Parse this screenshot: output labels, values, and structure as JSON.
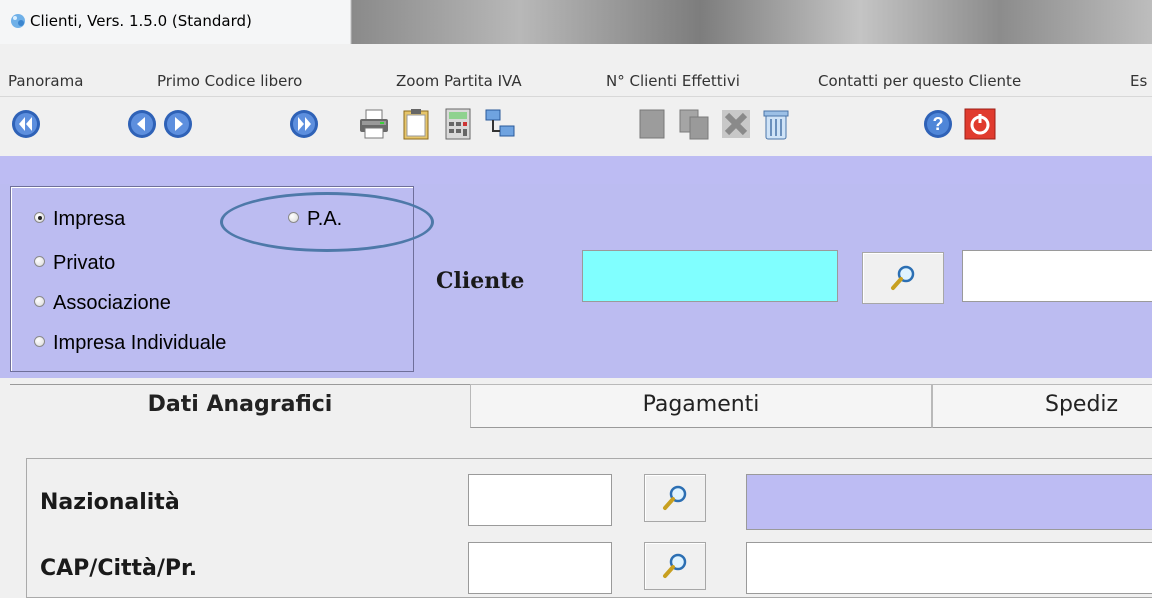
{
  "window": {
    "title": "Clienti, Vers. 1.5.0 (Standard)"
  },
  "menu": [
    {
      "label": "Panorama"
    },
    {
      "label": "Primo Codice libero"
    },
    {
      "label": "Zoom Partita IVA"
    },
    {
      "label": "N° Clienti Effettivi"
    },
    {
      "label": "Contatti per questo Cliente"
    },
    {
      "label": "Es"
    }
  ],
  "toolbar": [
    {
      "icon": "first-record-icon"
    },
    {
      "icon": "previous-record-icon"
    },
    {
      "icon": "next-record-icon"
    },
    {
      "icon": "last-record-icon"
    },
    {
      "icon": "print-icon"
    },
    {
      "icon": "clipboard-icon"
    },
    {
      "icon": "calculator-icon"
    },
    {
      "icon": "network-icon"
    },
    {
      "icon": "new-record-icon"
    },
    {
      "icon": "copy-record-icon"
    },
    {
      "icon": "delete-record-icon"
    },
    {
      "icon": "trash-icon"
    },
    {
      "icon": "help-icon"
    },
    {
      "icon": "exit-icon"
    }
  ],
  "client_type": {
    "options": [
      {
        "label": "Impresa",
        "selected": true
      },
      {
        "label": "P.A.",
        "selected": false,
        "highlighted": true
      },
      {
        "label": "Privato",
        "selected": false
      },
      {
        "label": "Associazione",
        "selected": false
      },
      {
        "label": "Impresa Individuale",
        "selected": false
      }
    ]
  },
  "cliente": {
    "label": "Cliente",
    "code_value": "",
    "name_value": "",
    "lookup_icon": "magnifier-icon"
  },
  "tabs": [
    {
      "label": "Dati Anagrafici",
      "active": true
    },
    {
      "label": "Pagamenti",
      "active": false
    },
    {
      "label": "Spediz",
      "active": false
    }
  ],
  "form": {
    "nazionalita": {
      "label": "Nazionalità",
      "code_value": "",
      "description_value": ""
    },
    "cap": {
      "label": "CAP/Città/Pr.",
      "code_value": "",
      "city_value": ""
    }
  },
  "colors": {
    "panel": "#bcbcf1",
    "cliente_input": "#80ffff",
    "highlight_ellipse": "#4e79a9",
    "nazionalita_description": "#bdbcf3"
  }
}
